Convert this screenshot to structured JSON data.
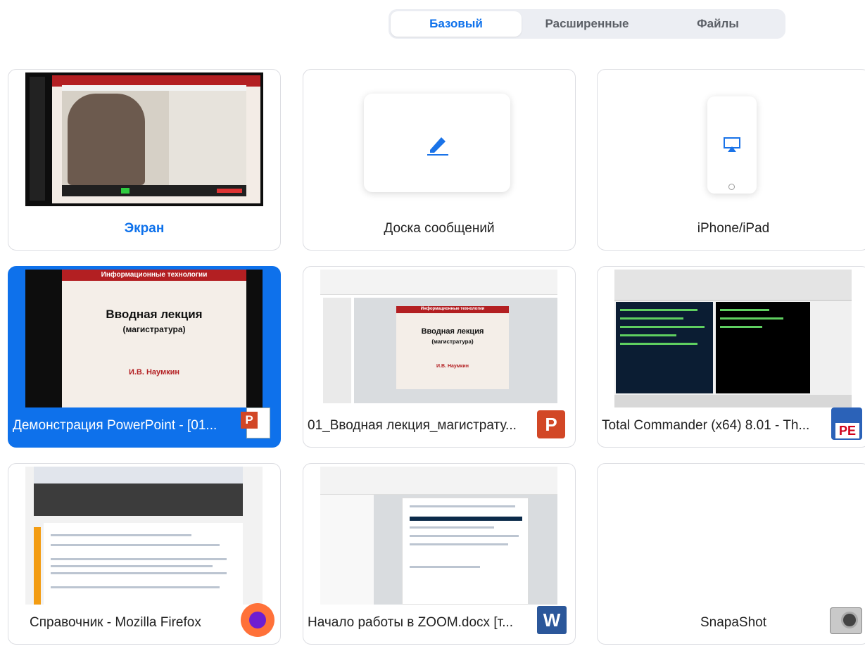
{
  "tabs": [
    {
      "label": "Базовый",
      "active": true
    },
    {
      "label": "Расширенные",
      "active": false
    },
    {
      "label": "Файлы",
      "active": false
    }
  ],
  "cards": {
    "screen": {
      "label": "Экран"
    },
    "whiteboard": {
      "label": "Доска сообщений"
    },
    "iphone": {
      "label": "iPhone/iPad"
    },
    "ppt_show": {
      "label": "Демонстрация PowerPoint - [01...",
      "slide_header": "Информационные технологии",
      "slide_title": "Вводная лекция",
      "slide_subtitle": "(магистратура)",
      "slide_author": "И.В. Наумкин"
    },
    "ppt_file": {
      "label": "01_Вводная лекция_магистрату...",
      "slide_header": "Информационные технологии",
      "slide_title": "Вводная лекция",
      "slide_subtitle": "(магистратура)",
      "slide_author": "И.В. Наумкин"
    },
    "total_commander": {
      "label": "Total Commander (x64) 8.01 - Th...",
      "icon_text": "PE"
    },
    "firefox": {
      "label": "Справочник - Mozilla Firefox"
    },
    "word": {
      "label": "Начало работы в ZOOM.docx [т...",
      "icon_text": "W"
    },
    "snapashot": {
      "label": "SnapaShot"
    }
  },
  "colors": {
    "accent": "#0e71eb",
    "slide_red": "#b31f22"
  }
}
